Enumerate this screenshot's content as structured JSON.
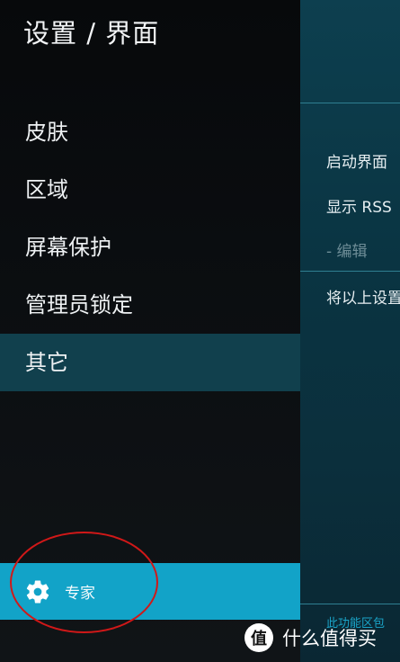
{
  "header": {
    "title": "设置 / 界面"
  },
  "sidebar": {
    "items": [
      {
        "label": "皮肤"
      },
      {
        "label": "区域"
      },
      {
        "label": "屏幕保护"
      },
      {
        "label": "管理员锁定"
      },
      {
        "label": "其它",
        "selected": true
      }
    ],
    "expert": {
      "label": "专家",
      "icon": "gear-icon"
    }
  },
  "content": {
    "options": [
      {
        "label": "启动界面"
      },
      {
        "label": "显示 RSS"
      },
      {
        "label": "- 编辑",
        "disabled": true
      },
      {
        "label": "将以上设置"
      }
    ],
    "footer_text": "此功能区包"
  },
  "watermark": {
    "logo_char": "值",
    "text": "什么值得买"
  },
  "colors": {
    "sidebar_bg": "#0c0f12",
    "selected_bg": "#11404d",
    "expert_bg": "#12a3c8",
    "content_bg": "#0a3442",
    "annotation": "#d11818"
  }
}
